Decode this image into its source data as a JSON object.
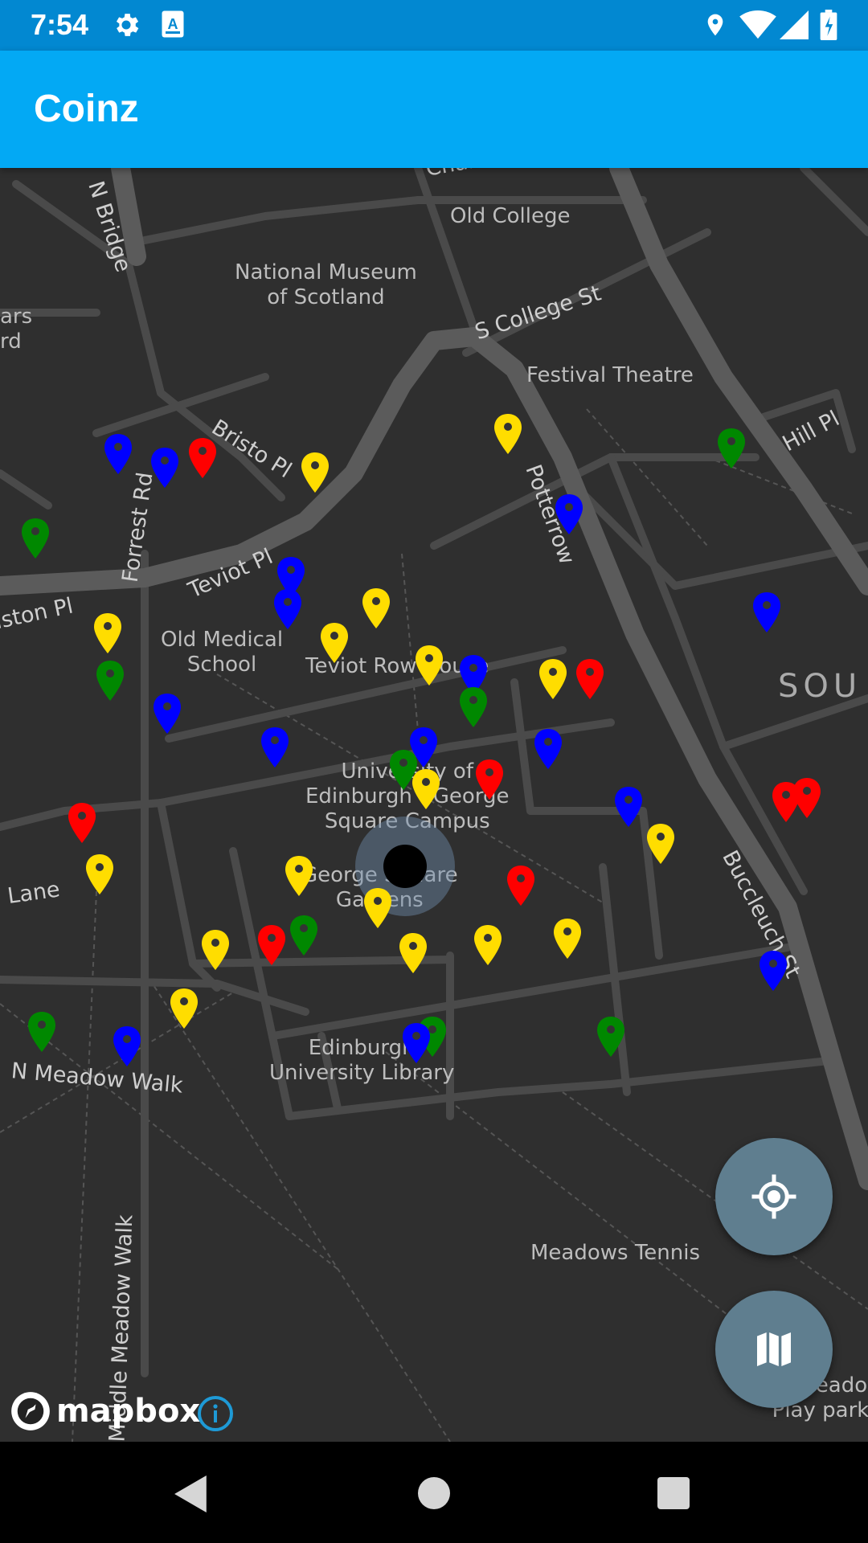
{
  "status_bar": {
    "time": "7:54",
    "left_icons": [
      "gear-icon",
      "a-notification-icon"
    ],
    "right_icons": [
      "location-icon",
      "wifi-icon",
      "signal-icon",
      "battery-icon"
    ]
  },
  "app_bar": {
    "title": "Coinz",
    "color": "#03a9f4"
  },
  "map": {
    "provider": "mapbox",
    "style": "dark",
    "places": [
      {
        "id": "old-college",
        "text": "Old College"
      },
      {
        "id": "national-museum",
        "text": "National Museum\nof Scotland"
      },
      {
        "id": "festival-theatre",
        "text": "Festival Theatre"
      },
      {
        "id": "old-medical-school",
        "text": "Old Medical\nSchool"
      },
      {
        "id": "teviot-row-house",
        "text": "Teviot Row House"
      },
      {
        "id": "george-square-campus",
        "text": "University of\nEdinburgh - George\nSquare Campus"
      },
      {
        "id": "george-square-gardens",
        "text": "George Square\nGardens"
      },
      {
        "id": "university-library",
        "text": "Edinburgh\nUniversity Library"
      },
      {
        "id": "meadows-tennis",
        "text": "Meadows Tennis"
      },
      {
        "id": "meadows-play-park",
        "text": "East Meadows\nPlay park"
      },
      {
        "id": "south",
        "text": "SOU"
      },
      {
        "id": "ars-rd",
        "text": "ars\nrd"
      }
    ],
    "streets": [
      "Chambers St",
      "N Bridge",
      "S College St",
      "Bristo Pl",
      "Forrest Rd",
      "Teviot Pl",
      "Potterrow",
      "Hill Pl",
      "Lauriston Pl",
      "Buccleuch St",
      "N Meadow Walk",
      "Middle Meadow Walk",
      "Meadow Lane"
    ],
    "coin_colors": {
      "red": "#ff0000",
      "yellow": "#ffdd00",
      "green": "#008800",
      "blue": "#0000ff"
    },
    "user_location_icon": "user-location-dot"
  },
  "fabs": [
    {
      "id": "locate",
      "icon": "crosshair-icon"
    },
    {
      "id": "map-style",
      "icon": "map-icon"
    }
  ],
  "attribution": {
    "logo_text": "mapbox",
    "info_icon": "info-icon"
  },
  "nav_bar": {
    "icons": [
      "back-icon",
      "home-icon",
      "recents-icon"
    ]
  }
}
